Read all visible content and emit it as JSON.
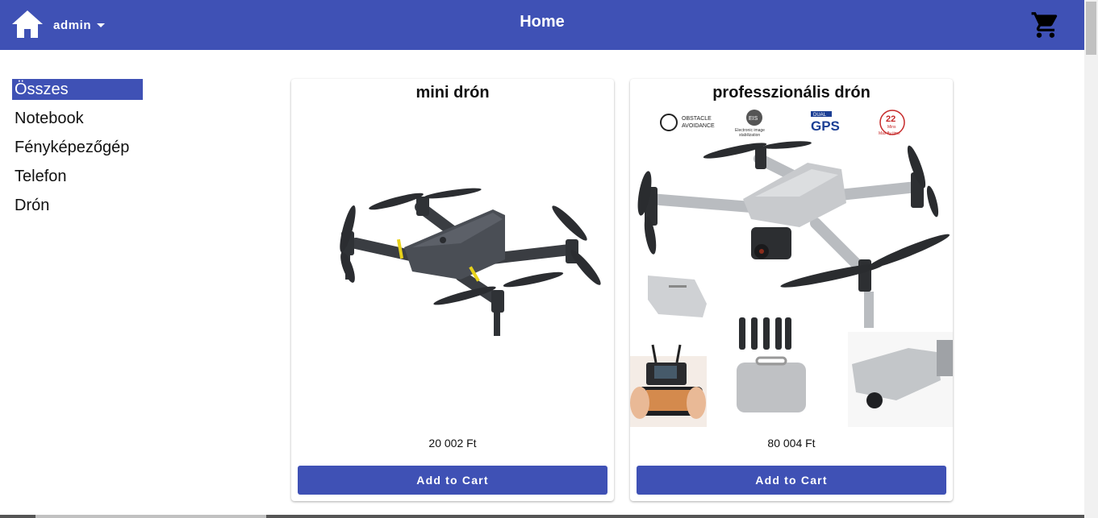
{
  "toolbar": {
    "title": "Home",
    "user": "admin",
    "icons": {
      "home": "home-icon",
      "cart": "cart-icon",
      "user_menu": "caret-down-icon"
    }
  },
  "categories": [
    {
      "label": "Összes",
      "active": true
    },
    {
      "label": "Notebook",
      "active": false
    },
    {
      "label": "Fényképezőgép",
      "active": false
    },
    {
      "label": "Telefon",
      "active": false
    },
    {
      "label": "Drón",
      "active": false
    }
  ],
  "products": [
    {
      "name": "mini drón",
      "price": "20 002 Ft",
      "button": "Add to Cart",
      "image": "mini-drone-image"
    },
    {
      "name": "professzionális drón",
      "price": "80 004 Ft",
      "button": "Add to Cart",
      "image": "professional-drone-image",
      "image_badges": [
        "OBSTACLE",
        "AVOIDANCE",
        "EIS",
        "Electronic image",
        "stabilization",
        "DUAL",
        "GPS",
        "22",
        "Mins",
        "Max fly time"
      ]
    }
  ],
  "colors": {
    "primary": "#3f51b5",
    "background": "#ffffff",
    "text": "#111111"
  }
}
